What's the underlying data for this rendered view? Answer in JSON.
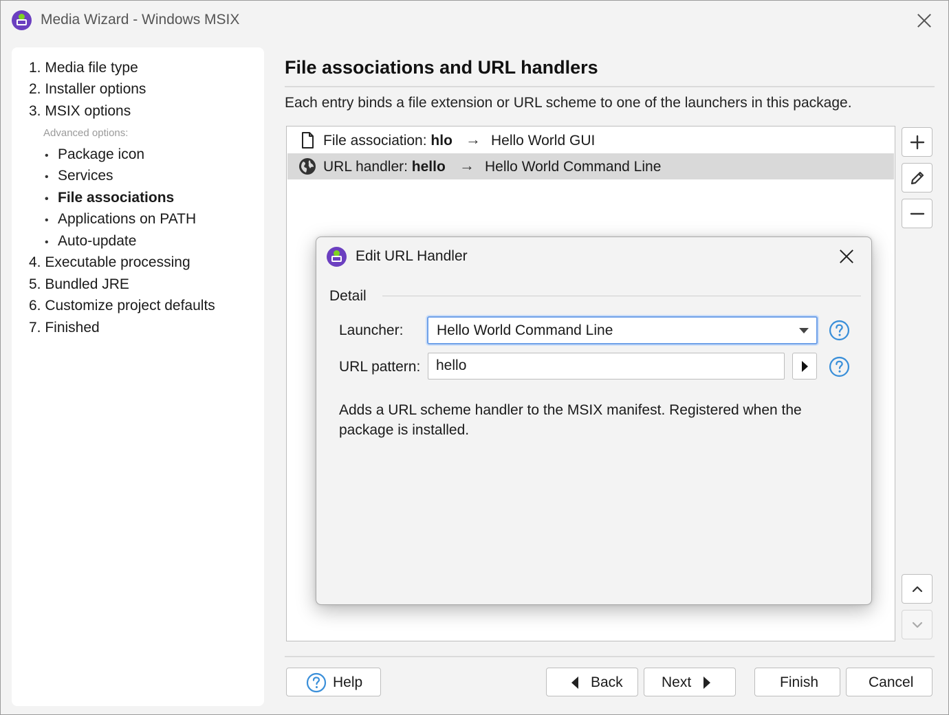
{
  "window": {
    "title": "Media Wizard - Windows MSIX"
  },
  "sidebar": {
    "steps": [
      "1. Media file type",
      "2. Installer options",
      "3. MSIX options",
      "4. Executable processing",
      "5. Bundled JRE",
      "6. Customize project defaults",
      "7. Finished"
    ],
    "advanced_label": "Advanced options:",
    "advanced_items": [
      "Package icon",
      "Services",
      "File associations",
      "Applications on PATH",
      "Auto-update"
    ],
    "active_item": "File associations",
    "bullet": "•"
  },
  "page": {
    "title": "File associations and URL handlers",
    "description": "Each entry binds a file extension or URL scheme to one of the launchers in this package."
  },
  "entries": [
    {
      "icon": "document-icon",
      "prefix": "File association: ",
      "name": "hlo",
      "arrow": "→",
      "target": "Hello World GUI",
      "selected": false
    },
    {
      "icon": "globe-icon",
      "prefix": "URL handler: ",
      "name": "hello",
      "arrow": "→",
      "target": "Hello World Command Line",
      "selected": true
    }
  ],
  "footer": {
    "help": "Help",
    "back": "Back",
    "next": "Next",
    "finish": "Finish",
    "cancel": "Cancel"
  },
  "dialog": {
    "title": "Edit URL Handler",
    "section": "Detail",
    "launcher_label": "Launcher:",
    "launcher_value": "Hello World Command Line",
    "url_label": "URL pattern:",
    "url_value": "hello",
    "description": "Adds a URL scheme handler to the MSIX manifest. Registered when the package is installed."
  },
  "colors": {
    "accent": "#6ea0e8",
    "help_icon": "#3a8fd9",
    "app_icon": "#6b3fc0",
    "app_icon_dot": "#7ed321",
    "selection": "#d9d9d9"
  }
}
